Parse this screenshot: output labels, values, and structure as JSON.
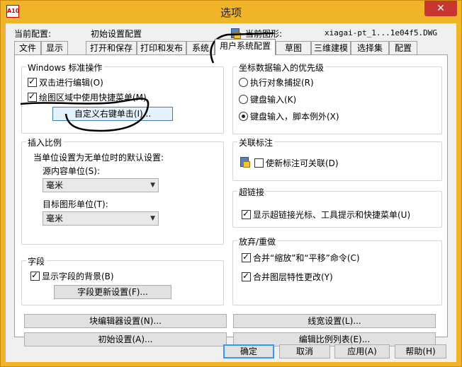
{
  "window": {
    "title": "选项",
    "close_glyph": "✕",
    "app_icon_text": "A10"
  },
  "profile": {
    "current_profile_label": "当前配置:",
    "current_profile_value": "初始设置配置",
    "current_drawing_label": "当前图形:",
    "current_drawing_value": "xiagai-pt_1...1e04f5.DWG"
  },
  "tabs": [
    {
      "label": "文件"
    },
    {
      "label": "显示"
    },
    {
      "label": "打开和保存"
    },
    {
      "label": "打印和发布"
    },
    {
      "label": "系统"
    },
    {
      "label": "用户系统配置"
    },
    {
      "label": "草图"
    },
    {
      "label": "三维建模"
    },
    {
      "label": "选择集"
    },
    {
      "label": "配置"
    }
  ],
  "windows_ops": {
    "title": "Windows 标准操作",
    "double_click": {
      "label": "双击进行编辑(O)",
      "checked": true
    },
    "shortcut_menu": {
      "label": "绘图区域中使用快捷菜单(M)",
      "checked": true
    },
    "right_click_button": "自定义右键单击(I)..."
  },
  "insert_scale": {
    "title": "插入比例",
    "desc": "当单位设置为无单位时的默认设置:",
    "source_label": "源内容单位(S):",
    "source_value": "毫米",
    "target_label": "目标图形单位(T):",
    "target_value": "毫米"
  },
  "fields": {
    "title": "字段",
    "show_bg": {
      "label": "显示字段的背景(B)",
      "checked": true
    },
    "update_button": "字段更新设置(F)..."
  },
  "coord_input": {
    "title": "坐标数据输入的优先级",
    "opt1": "执行对象捕捉(R)",
    "opt2": "键盘输入(K)",
    "opt3": "键盘输入，脚本例外(X)",
    "selected": "opt3"
  },
  "assoc_dim": {
    "title": "关联标注",
    "make_assoc": {
      "label": "使新标注可关联(D)",
      "checked": false
    }
  },
  "hyperlink": {
    "title": "超链接",
    "show_cursor": {
      "label": "显示超链接光标、工具提示和快捷菜单(U)",
      "checked": true
    }
  },
  "undo_redo": {
    "title": "放弃/重做",
    "combine_zoom": {
      "label": "合并“缩放”和“平移”命令(C)",
      "checked": true
    },
    "combine_layer": {
      "label": "合并图层特性更改(Y)",
      "checked": true
    }
  },
  "bottom_buttons": {
    "block_editor": "块编辑器设置(N)...",
    "lineweight": "线宽设置(L)...",
    "initial": "初始设置(A)...",
    "scale_list": "编辑比例列表(E)..."
  },
  "dialog_buttons": {
    "ok": "确定",
    "cancel": "取消",
    "apply": "应用(A)",
    "help": "帮助(H)"
  }
}
